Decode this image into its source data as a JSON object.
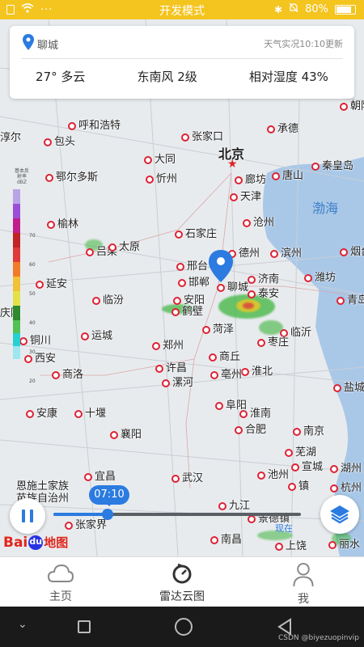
{
  "status_bar": {
    "title": "开发模式",
    "battery": "80%",
    "bg_color": "#f4c41f"
  },
  "weather_card": {
    "location": "聊城",
    "updated": "天气实况10:10更新",
    "temperature": "27° 多云",
    "wind": "东南风 2级",
    "humidity": "相对湿度 43%"
  },
  "map": {
    "cities": {
      "beijing": "北京",
      "tianjin": "天津",
      "langfang": "廊坊",
      "chengde": "承德",
      "zhangjiakou": "张家口",
      "datong": "大同",
      "hohhot": "呼和浩特",
      "baotou": "包头",
      "ordos": "鄂尔多斯",
      "yulin": "榆林",
      "luliang": "吕梁",
      "taiyuan": "太原",
      "yanan": "延安",
      "shijiazhuang": "石家庄",
      "cangzhou": "沧州",
      "tangshan": "唐山",
      "qinhuangdao": "秦皇岛",
      "dezhou": "德州",
      "binzhou": "滨州",
      "xingtai": "邢台",
      "handan": "邯郸",
      "liaocheng": "聊城",
      "jinan": "济南",
      "taian": "泰安",
      "anyang": "安阳",
      "hebi": "鹤壁",
      "linfen": "临汾",
      "yuncheng": "运城",
      "heze": "菏泽",
      "linyi": "临沂",
      "zaozhuang": "枣庄",
      "weifang": "潍坊",
      "qingdao": "青岛",
      "tongchuan": "铜川",
      "xian": "西安",
      "shangluo": "商洛",
      "zhengzhou": "郑州",
      "xuchang": "许昌",
      "luohe": "漯河",
      "shangqiu": "商丘",
      "bozhou": "亳州",
      "huaibei": "淮北",
      "ankang": "安康",
      "shiyan": "十堰",
      "xiangyang": "襄阳",
      "fuyang": "阜阳",
      "huainan": "淮南",
      "hefei": "合肥",
      "nanjing": "南京",
      "yancheng": "盐城",
      "wuhu": "芜湖",
      "xuancheng": "宣城",
      "huzhou": "湖州",
      "hangzhou": "杭州",
      "chizhou": "池州",
      "yichang": "宜昌",
      "wuhan": "武汉",
      "jiujiang": "九江",
      "jingdezhen": "景德镇",
      "nanchang": "南昌",
      "shangrao": "上饶",
      "lishui": "丽水",
      "enshi": "恩施土家族苗族自治州",
      "zhangjiajie": "张家界",
      "chaoyang": "朝阳",
      "yantai": "烟台",
      "zhenjiang": "镇",
      "xinzhou": "忻州",
      "zhangjiakou2": "淳尔",
      "bohai": "渤海"
    },
    "radar_legend_title": "基本反射率dBZ",
    "radar_legend_values": [
      "70",
      "60",
      "50",
      "40",
      "30",
      "20"
    ]
  },
  "player": {
    "time": "07:10",
    "progress": 0.22,
    "now_label": "现在"
  },
  "baidu_logo": {
    "text1": "Bai",
    "text2": "du",
    "text3": "地图"
  },
  "tabs": [
    {
      "label": "主页",
      "icon": "cloud-icon"
    },
    {
      "label": "雷达云图",
      "icon": "radar-clock-icon"
    },
    {
      "label": "我",
      "icon": "person-icon"
    }
  ],
  "watermark": "CSDN @biyezuopinvip"
}
